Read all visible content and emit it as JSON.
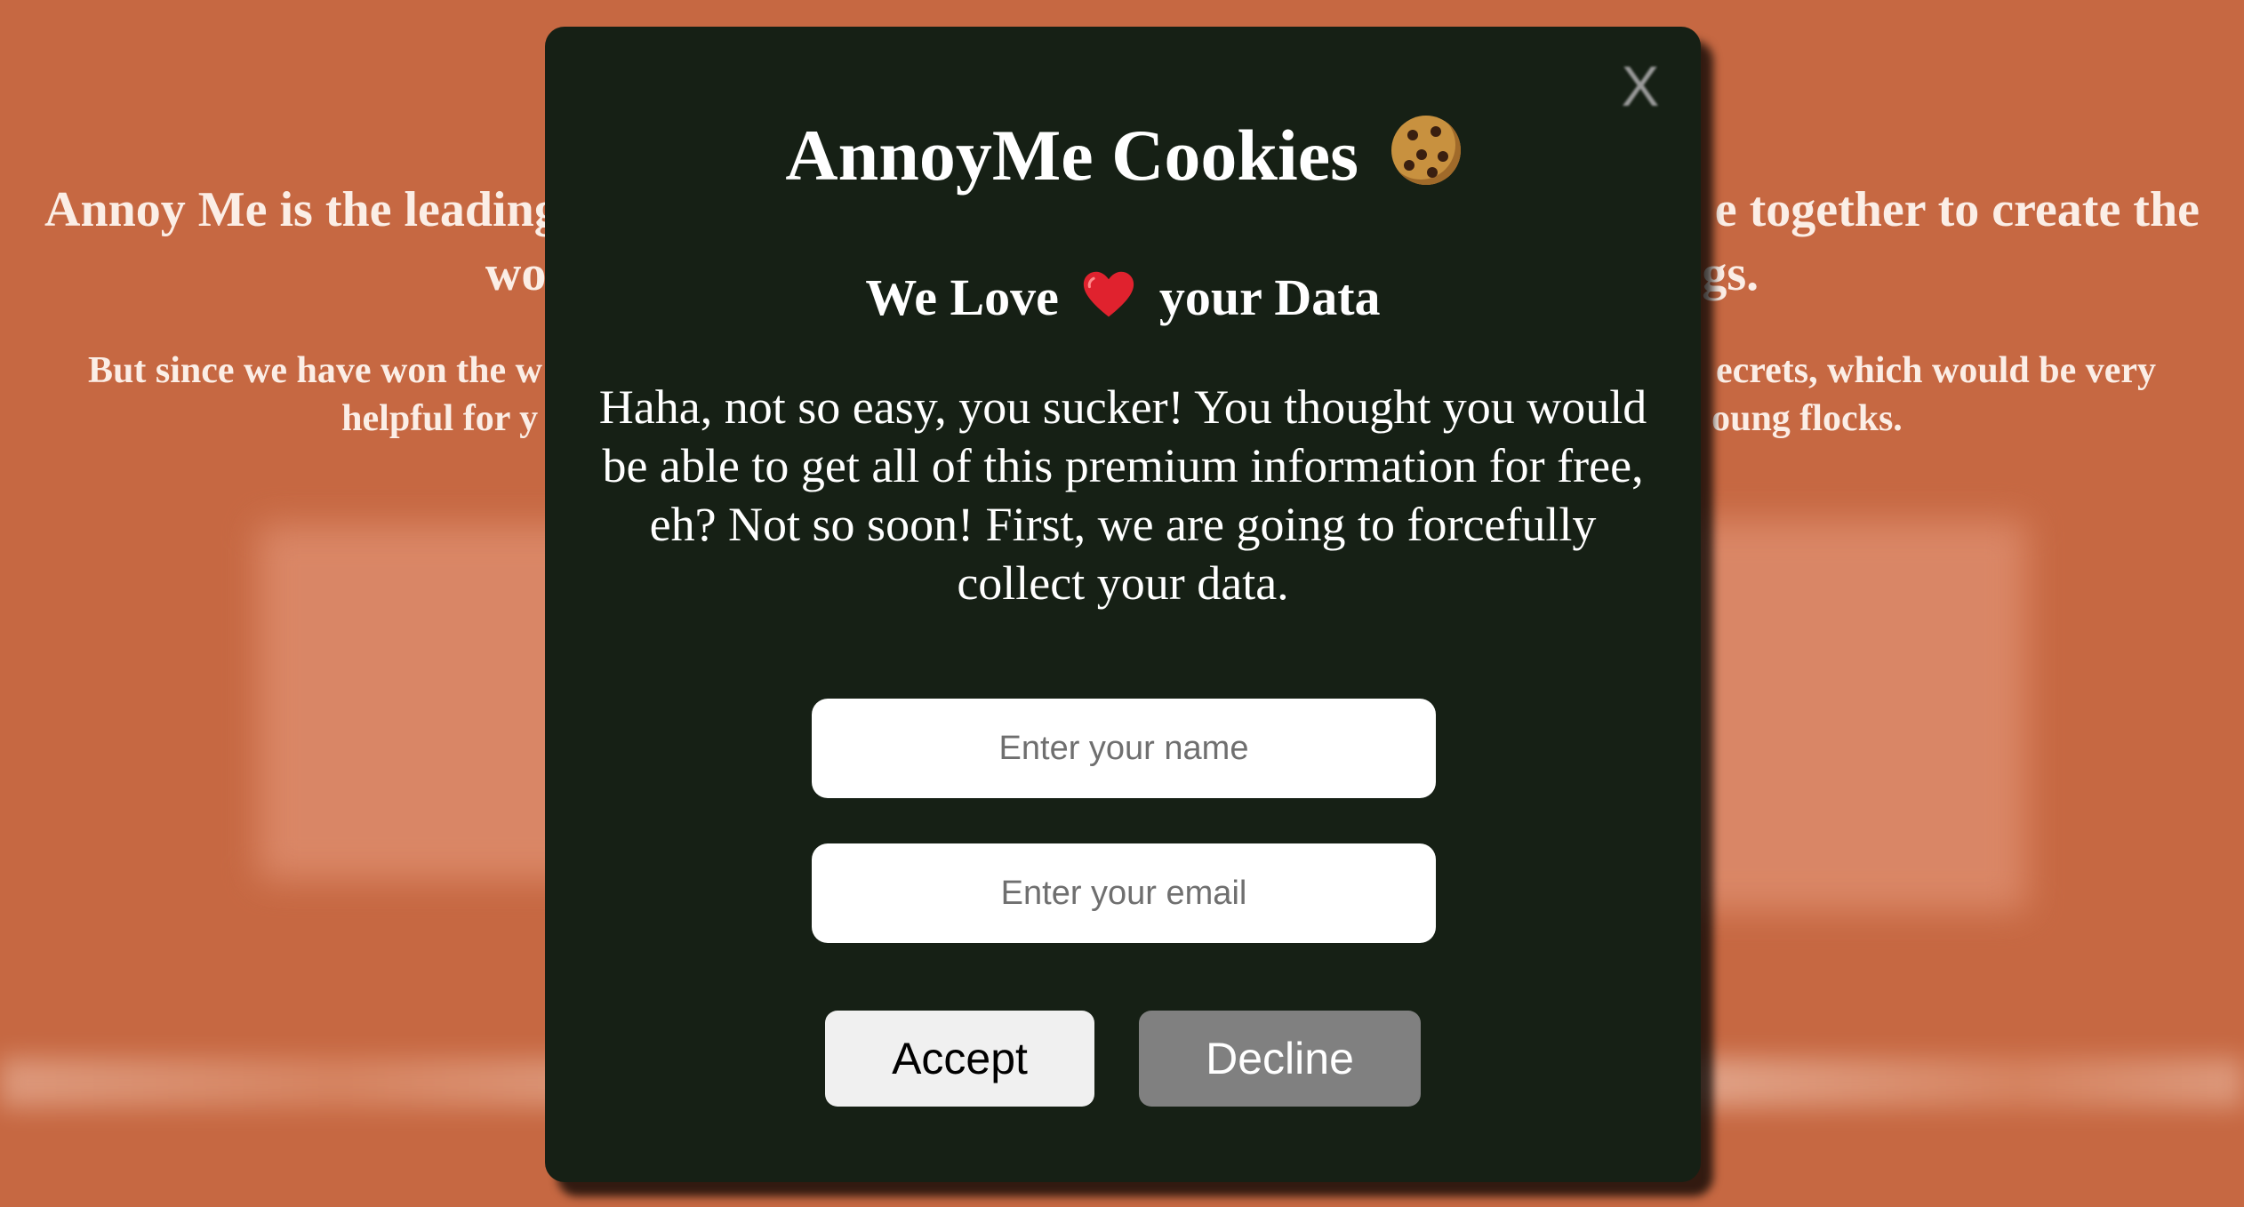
{
  "background": {
    "headline_line1_left": "Annoy Me is the leading",
    "headline_line1_right": "e together to create the",
    "headline_line2_left": "wo",
    "headline_line2_right": "gs.",
    "sub_line1_left": "But since we have won the w",
    "sub_line1_right": "ecrets, which would be very",
    "sub_line2_left": "helpful for y",
    "sub_line2_right": "oung flocks."
  },
  "modal": {
    "close_label": "X",
    "title": "AnnoyMe Cookies",
    "title_icon": "cookie-icon",
    "subtitle_before": "We Love",
    "subtitle_icon": "heart-icon",
    "subtitle_after": "your Data",
    "body_text": "Haha, not so easy, you sucker! You thought you would be able to get all of this premium information for free, eh? Not so soon! First, we are going to forcefully collect your data.",
    "name_placeholder": "Enter your name",
    "email_placeholder": "Enter your email",
    "accept_label": "Accept",
    "decline_label": "Decline"
  },
  "colors": {
    "page_background": "#c66842",
    "modal_background": "#162015",
    "accept_button": "#f0f0f0",
    "decline_button": "#808080",
    "heart": "#e0222e"
  }
}
